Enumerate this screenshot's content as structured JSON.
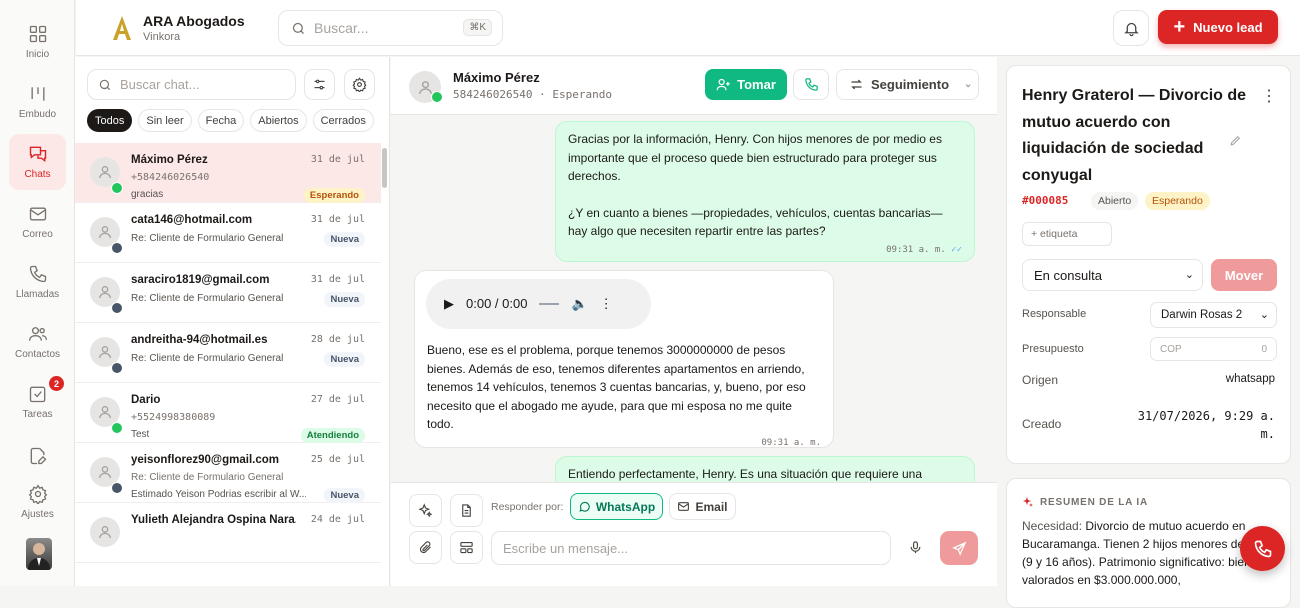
{
  "colors": {
    "accent": "#dc2626",
    "green": "#10b981",
    "whatsapp": "#22c55e",
    "email": "#475569"
  },
  "nav": {
    "items": [
      {
        "label": "Inicio",
        "icon": "grid-icon"
      },
      {
        "label": "Embudo",
        "icon": "funnel-icon"
      },
      {
        "label": "Chats",
        "icon": "chat-icon",
        "active": true
      },
      {
        "label": "Correo",
        "icon": "mail-icon"
      },
      {
        "label": "Llamadas",
        "icon": "phone-icon"
      },
      {
        "label": "Contactos",
        "icon": "users-icon"
      },
      {
        "label": "Tareas",
        "icon": "check-square-icon",
        "badge": "2"
      },
      {
        "label": "",
        "icon": "edit-file-icon"
      },
      {
        "label": "Ajustes",
        "icon": "gear-icon"
      }
    ]
  },
  "brand": {
    "name": "ARA Abogados",
    "sub": "Vinkora"
  },
  "search": {
    "placeholder": "Buscar...",
    "shortcut": "⌘K"
  },
  "header": {
    "new_lead": "Nuevo lead"
  },
  "chatlist": {
    "search_placeholder": "Buscar chat...",
    "filters": [
      "Todos",
      "Sin leer",
      "Fecha",
      "Abiertos",
      "Cerrados"
    ],
    "items": [
      {
        "name": "Máximo Pérez",
        "date": "31 de jul",
        "sub": "+584246026540",
        "preview": "gracias",
        "badge": "Esperando",
        "channel": "whatsapp",
        "selected": true
      },
      {
        "name": "cata146@hotmail.com",
        "date": "31 de jul",
        "sub": "",
        "preview": "Re: Cliente de Formulario General",
        "badge": "Nueva",
        "channel": "email"
      },
      {
        "name": "saraciro1819@gmail.com",
        "date": "31 de jul",
        "sub": "",
        "preview": "Re: Cliente de Formulario General",
        "badge": "Nueva",
        "channel": "email"
      },
      {
        "name": "andreitha-94@hotmail.es",
        "date": "28 de jul",
        "sub": "",
        "preview": "Re: Cliente de Formulario General",
        "badge": "Nueva",
        "channel": "email"
      },
      {
        "name": "Dario",
        "date": "27 de jul",
        "sub": "+5524998380089",
        "preview": "Test",
        "badge": "Atendiendo",
        "channel": "whatsapp"
      },
      {
        "name": "yeisonflorez90@gmail.com",
        "date": "25 de jul",
        "sub": "Re: Cliente de Formulario General",
        "preview": "Estimado Yeison Podrias escribir al W...",
        "badge": "Nueva",
        "channel": "email"
      },
      {
        "name": "Yulieth Alejandra Ospina Nara...",
        "date": "24 de jul",
        "sub": "",
        "preview": "",
        "badge": "",
        "channel": "email"
      }
    ]
  },
  "conversation": {
    "name": "Máximo Pérez",
    "sub": "584246026540 · Esperando",
    "take": "Tomar",
    "status": "Seguimiento",
    "messages": [
      {
        "dir": "out",
        "text": "Gracias por la información, Henry. Con hijos menores de por medio es importante que el proceso quede bien estructurado para proteger sus derechos.",
        "text2": "¿Y en cuanto a bienes —propiedades, vehículos, cuentas bancarias— hay algo que necesiten repartir entre las partes?",
        "time": "09:31 a. m."
      },
      {
        "dir": "in",
        "audio": "0:00 / 0:00",
        "text": "Bueno, ese es el problema, porque tenemos 3000000000 de pesos bienes. Además de eso, tenemos diferentes apartamentos en arriendo, tenemos 14 vehículos, tenemos 3 cuentas bancarias, y, bueno, por eso necesito que el abogado me ayude, para que mi esposa no me quite todo.",
        "time": "09:31 a. m."
      },
      {
        "dir": "out",
        "text": "Entiendo perfectamente, Henry. Es una situación que requiere una"
      }
    ],
    "reply_by": "Responder por:",
    "channels": [
      "WhatsApp",
      "Email"
    ],
    "input_placeholder": "Escribe un mensaje..."
  },
  "lead": {
    "title": "Henry Graterol — Divorcio de mutuo acuerdo con liquidación de sociedad conyugal",
    "number": "#000085",
    "status": "Abierto",
    "stage_badge": "Esperando",
    "tag_placeholder": "+ etiqueta",
    "stage": "En consulta",
    "move": "Mover",
    "fields": {
      "responsable_label": "Responsable",
      "responsable": "Darwin Rosas 2",
      "presupuesto_label": "Presupuesto",
      "currency": "COP",
      "budget": "0",
      "origen_label": "Origen",
      "origen": "whatsapp",
      "creado_label": "Creado",
      "creado": "31/07/2026, 9:29 a. m."
    }
  },
  "ai": {
    "heading": "RESUMEN DE LA IA",
    "label": "Necesidad:",
    "text": "Divorcio de mutuo acuerdo en Bucaramanga. Tienen 2 hijos menores de edad (9 y 16 años). Patrimonio significativo: bienes valorados en $3.000.000.000,"
  }
}
